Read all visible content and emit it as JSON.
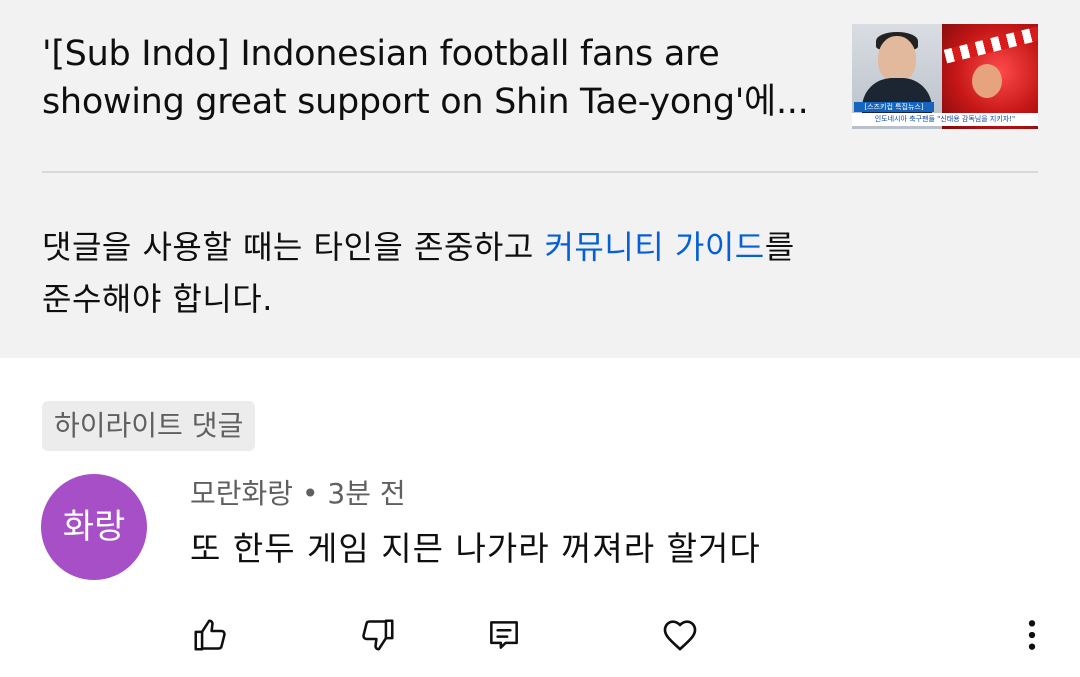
{
  "video": {
    "title_line1": "'[Sub Indo] Indonesian football fans are",
    "title_line2": "showing great support on Shin Tae-yong'에...",
    "thumbnail": {
      "caption_top": "[스즈키컵 특집뉴스]",
      "caption_bottom": "인도네시아 축구팬들 \"신태용 감독님을 지키자!\""
    }
  },
  "guideline": {
    "text_before_link": "댓글을 사용할 때는 타인을 존중하고 ",
    "link_text": "커뮤니티 가이드",
    "text_after_link": "를",
    "line2": "준수해야 합니다."
  },
  "highlight_chip": "하이라이트 댓글",
  "comment": {
    "avatar_text": "화랑",
    "avatar_color": "#a64fc7",
    "author": "모란화랑",
    "separator": " • ",
    "time": "3분 전",
    "text": "또 한두 게임 지믄 나가라 꺼져라 할거다"
  },
  "actions": [
    "thumbs-up-icon",
    "thumbs-down-icon",
    "reply-icon",
    "heart-icon",
    "more-vert-icon"
  ],
  "colors": {
    "link": "#065fd4",
    "panel_background": "#f2f2f2"
  }
}
